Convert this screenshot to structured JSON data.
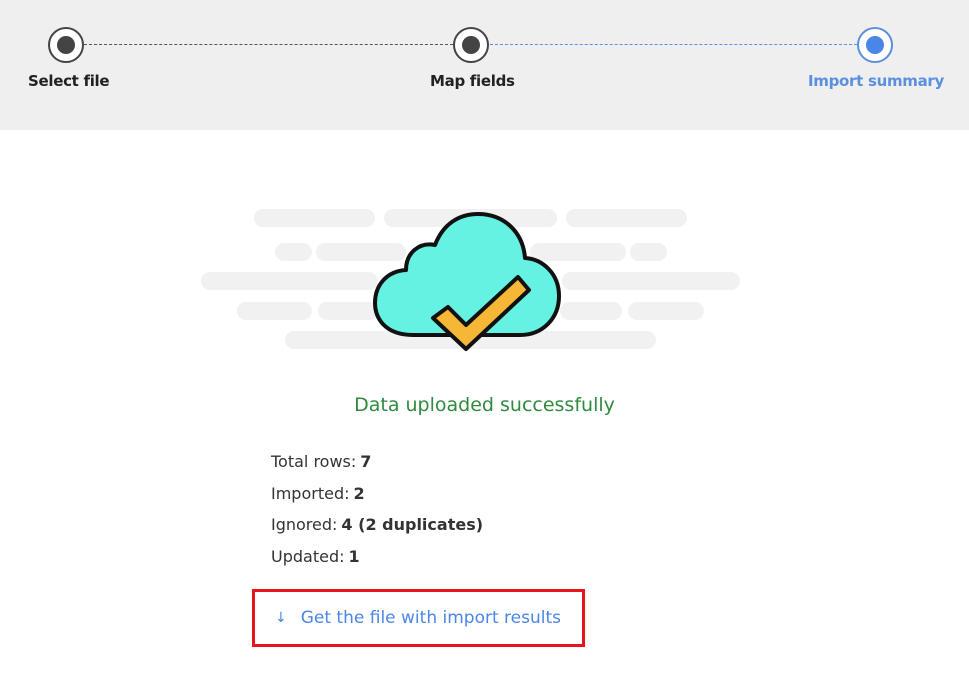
{
  "stepper": {
    "steps": [
      {
        "label": "Select file",
        "state": "completed"
      },
      {
        "label": "Map fields",
        "state": "completed"
      },
      {
        "label": "Import summary",
        "state": "active"
      }
    ]
  },
  "colors": {
    "accent": "#4a86e8",
    "success": "#2e8b3e",
    "cloud_fill": "#66f2e2",
    "check_fill": "#f5b735",
    "highlight_border": "#e8141c"
  },
  "result": {
    "message": "Data uploaded successfully",
    "icon": "cloud-check-icon"
  },
  "stats": [
    {
      "label": "Total rows:",
      "value": "7"
    },
    {
      "label": "Imported:",
      "value": "2"
    },
    {
      "label": "Ignored:",
      "value": "4 (2 duplicates)"
    },
    {
      "label": "Updated:",
      "value": "1"
    }
  ],
  "download": {
    "icon": "arrow-down-icon",
    "label": "Get the file with import results"
  }
}
